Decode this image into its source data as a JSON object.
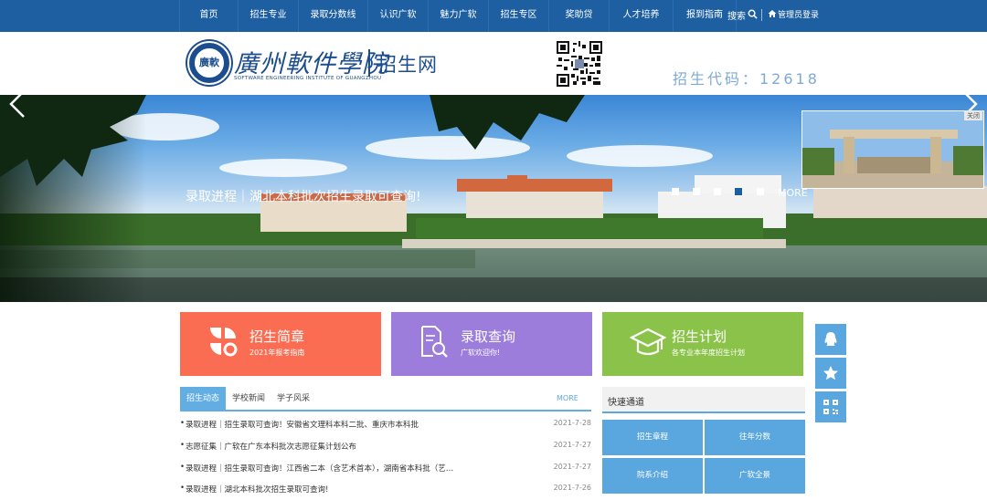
{
  "nav": {
    "items": [
      "首页",
      "招生专业",
      "录取分数线",
      "认识广软",
      "魅力广软",
      "招生专区",
      "奖助贷",
      "人才培养",
      "报到指南"
    ],
    "search_label": "搜索",
    "admin_login": "管理员登录"
  },
  "header": {
    "school_name": "廣州軟件學院",
    "school_name_en": "SOFTWARE ENGINEERING INSTITUTE OF GUANGZHOU",
    "seal_text": "廣軟",
    "site_title": "招生网",
    "enroll_code": "招生代码：12618"
  },
  "banner": {
    "caption": "录取进程｜湖北本科批次招生录取可查询!",
    "more": "MORE",
    "dot_count": 5,
    "active_dot": 3,
    "float_close": "关闭"
  },
  "cards": [
    {
      "title": "招生简章",
      "subtitle": "2021年报考指南",
      "color": "#fb6d53"
    },
    {
      "title": "录取查询",
      "subtitle": "广软欢迎你!",
      "color": "#9c7ddb"
    },
    {
      "title": "招生计划",
      "subtitle": "各专业本年度招生计划",
      "color": "#8bc34a"
    }
  ],
  "tabs": {
    "items": [
      "招生动态",
      "学校新闻",
      "学子风采"
    ],
    "active": 0,
    "more": "MORE"
  },
  "news": [
    {
      "title": "录取进程｜招生录取可查询！安徽省文理科本科二批、重庆市本科批",
      "date": "2021-7-28"
    },
    {
      "title": "志愿征集｜广软在广东本科批次志愿征集计划公布",
      "date": "2021-7-27"
    },
    {
      "title": "录取进程｜招生录取可查询！江西省二本（含艺术首本），湖南省本科批（艺…",
      "date": "2021-7-27"
    },
    {
      "title": "录取进程｜湖北本科批次招生录取可查询!",
      "date": "2021-7-26"
    }
  ],
  "quick": {
    "title": "快速通道",
    "buttons": [
      "招生章程",
      "往年分数",
      "院系介绍",
      "广软全景"
    ]
  },
  "colors": {
    "nav": "#1d5fa0",
    "brand": "#1c4d8e",
    "accent": "#5aa7e0"
  }
}
